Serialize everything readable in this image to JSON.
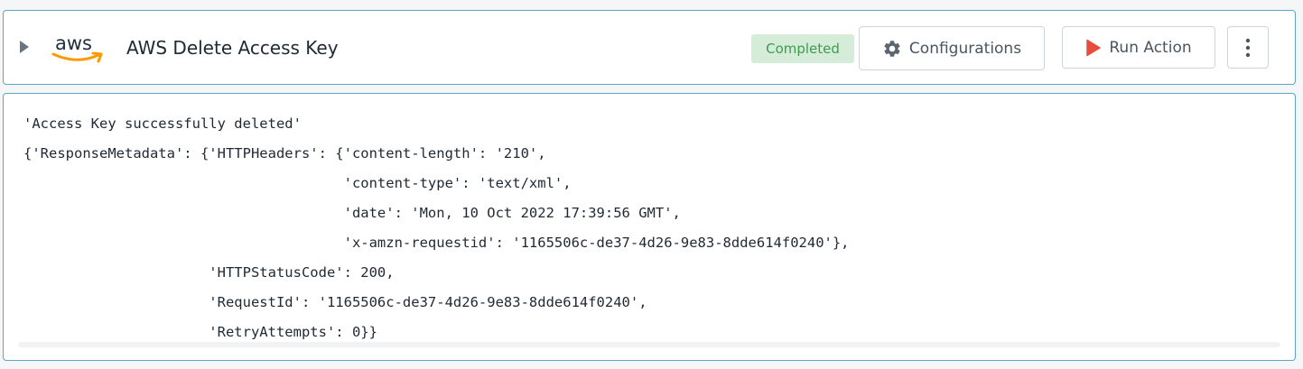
{
  "header": {
    "logo_text": "aws",
    "title": "AWS Delete Access Key",
    "status": "Completed",
    "configurations_label": "Configurations",
    "run_action_label": "Run Action"
  },
  "output": {
    "lines": [
      "'Access Key successfully deleted'",
      "{'ResponseMetadata': {'HTTPHeaders': {'content-length': '210',",
      "                                      'content-type': 'text/xml',",
      "                                      'date': 'Mon, 10 Oct 2022 17:39:56 GMT',",
      "                                      'x-amzn-requestid': '1165506c-de37-4d26-9e83-8dde614f0240'},",
      "                      'HTTPStatusCode': 200,",
      "                      'RequestId': '1165506c-de37-4d26-9e83-8dde614f0240',",
      "                      'RetryAttempts': 0}}"
    ]
  },
  "icons": {
    "expand": "caret-right-icon",
    "configurations": "gear-icon",
    "run_action": "play-icon",
    "more": "kebab-menu-icon"
  },
  "colors": {
    "border": "#5ba8c6",
    "status_bg": "#d4ecd8",
    "status_text": "#3f9a50",
    "play": "#e74c3c",
    "aws_orange": "#ff9900"
  }
}
